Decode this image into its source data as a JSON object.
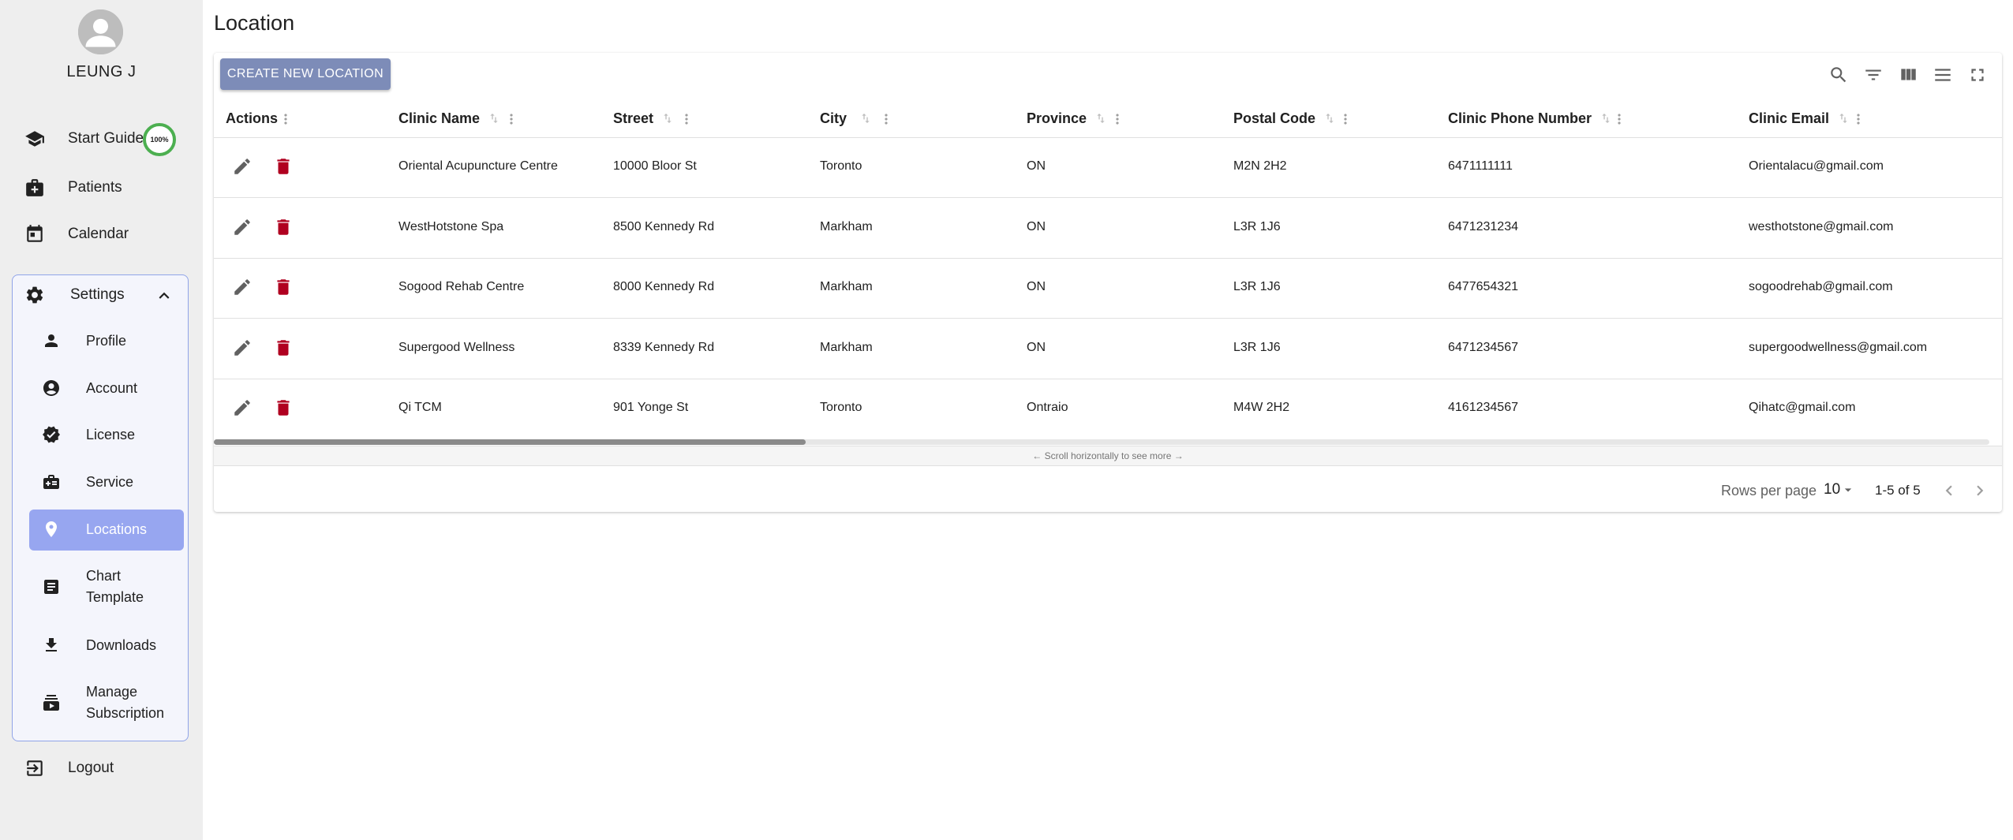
{
  "sidebar": {
    "username": "LEUNG J",
    "items": [
      {
        "label": "Start Guide",
        "icon": "school-icon"
      },
      {
        "label": "Patients",
        "icon": "medical-bag-icon"
      },
      {
        "label": "Calendar",
        "icon": "calendar-icon"
      }
    ],
    "progress": "100%",
    "settings": {
      "label": "Settings",
      "icon": "gear-icon",
      "items": [
        {
          "label": "Profile",
          "icon": "person-icon"
        },
        {
          "label": "Account",
          "icon": "account-circle-icon"
        },
        {
          "label": "License",
          "icon": "verified-badge-icon"
        },
        {
          "label": "Service",
          "icon": "medical-services-icon"
        },
        {
          "label": "Locations",
          "icon": "location-pin-icon",
          "active": true
        },
        {
          "label": "Chart Template",
          "label_line1": "Chart",
          "label_line2": "Template",
          "icon": "document-icon"
        },
        {
          "label": "Downloads",
          "icon": "download-icon"
        },
        {
          "label": "Manage Subscription",
          "label_line1": "Manage",
          "label_line2": "Subscription",
          "icon": "subscription-icon"
        }
      ]
    },
    "logout": "Logout"
  },
  "page": {
    "title": "Location",
    "create_button": "CREATE NEW LOCATION"
  },
  "table": {
    "columns": [
      "Actions",
      "Clinic Name",
      "Street",
      "City",
      "Province",
      "Postal Code",
      "Clinic Phone Number",
      "Clinic Email"
    ],
    "rows": [
      [
        "Oriental Acupuncture Centre",
        "10000 Bloor St",
        "Toronto",
        "ON",
        "M2N 2H2",
        "6471111111",
        "Orientalacu@gmail.com"
      ],
      [
        "WestHotstone Spa",
        "8500 Kennedy Rd",
        "Markham",
        "ON",
        "L3R 1J6",
        "6471231234",
        "westhotstone@gmail.com"
      ],
      [
        "Sogood Rehab Centre",
        "8000 Kennedy Rd",
        "Markham",
        "ON",
        "L3R 1J6",
        "6477654321",
        "sogoodrehab@gmail.com"
      ],
      [
        "Supergood Wellness",
        "8339 Kennedy Rd",
        "Markham",
        "ON",
        "L3R 1J6",
        "6471234567",
        "supergoodwellness@gmail.com"
      ],
      [
        "Qi TCM",
        "901 Yonge St",
        "Toronto",
        "Ontraio",
        "M4W 2H2",
        "4161234567",
        "Qihatc@gmail.com"
      ]
    ],
    "scroll_hint": "← Scroll horizontally to see more →"
  },
  "pagination": {
    "rows_per_page_label": "Rows per page",
    "rows_per_page_value": "10",
    "range": "1-5 of 5"
  },
  "colors": {
    "accent": "#97a6f0",
    "button": "#7d8cb8",
    "delete": "#b00020",
    "progress": "#4caf50"
  }
}
